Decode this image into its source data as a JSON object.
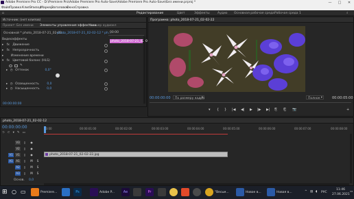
{
  "window": {
    "title": "Adobe Premiere Pro CC - D:\\Premiere Pro\\Adobe Premiere Pro Auto-Save\\Adobe Premiere Pro Auto-Save\\Без имени.prproj *",
    "controls": [
      "—",
      "□",
      "✕"
    ]
  },
  "menu": [
    "Файл",
    "Правка",
    "Клип",
    "Эпизод",
    "Маркер",
    "Заголовок",
    "Окно",
    "Справка"
  ],
  "workspaces": {
    "items": [
      "Редактирование",
      "Цвет",
      "Эффекты",
      "Аудио",
      "Основная рабочая среда",
      "Рабочая среда 1"
    ],
    "active": "Редактирование"
  },
  "effect_controls": {
    "tabs": [
      "Источник: (нет клипов)",
      "Элементы управления эффектами",
      "Микшер аудиокл"
    ],
    "master": "Основной * photo_2018-07-21_02-02...",
    "sequence": "photo_2018-07-21_02-02-12 * ph...",
    "timecode_ruler": [
      "00:00",
      "00:00:05:00"
    ],
    "clip_label": "photo_2018-07-21_02-02",
    "section": "Видеоэффекты",
    "effects": [
      {
        "name": "Движение",
        "prefix": "fx"
      },
      {
        "name": "Непрозрачность",
        "prefix": "fx"
      },
      {
        "name": "Изменение времени",
        "prefix": ""
      },
      {
        "name": "Цветовой баланс (HLS)",
        "prefix": "fx"
      }
    ],
    "params": [
      {
        "name": "Оттенок",
        "value": "0,0°"
      },
      {
        "name": "Освещенность",
        "value": "0,0"
      },
      {
        "name": "Насыщенность",
        "value": "0,0"
      }
    ],
    "footer_time": "00:00:00:00"
  },
  "program": {
    "title": "Программа: photo_2018-07-21_02-02-22",
    "timecode_left": "00:00:00:00",
    "fit": "По размеру кадра",
    "quality": "Полное",
    "timecode_right": "00:00:05:00",
    "transport": [
      "▾",
      "{",
      "}",
      "|◀",
      "◀|",
      "▶",
      "|▶",
      "▶|",
      "⎘",
      "⎗",
      "📷",
      "+"
    ],
    "image_desc": "flowers"
  },
  "timeline": {
    "tab": "photo_2018-07-21_02-02-12",
    "timecode": "00:00:00:00",
    "ruler": [
      "00:00",
      "00:00:01:00",
      "00:00:02:00",
      "00:00:03:00",
      "00:00:04:00",
      "00:00:05:00",
      "00:00:06:00",
      "00:00:07:00",
      "00:00:08:00",
      "00:00:09:00"
    ],
    "video_tracks": [
      "V3",
      "V2",
      "V1"
    ],
    "audio_tracks": [
      "A1",
      "A2",
      "A3"
    ],
    "master": "Основ.",
    "master_value": "0,0",
    "clip": "photo_2018-07-21_02-02-22.jpg",
    "track_buttons": [
      "M",
      "S"
    ]
  },
  "taskbar": {
    "items": [
      "Premiere...",
      "",
      "Ps",
      "Adobe P...",
      "Ae",
      "",
      "Pr",
      "",
      "\"Весьм...",
      "Новое в...",
      "Новая в..."
    ],
    "time": "11:46",
    "date": "27.06.2021",
    "lang": "РУС"
  },
  "colors": {
    "accent": "#5a9be0",
    "clip_pink": "#cf6ad1",
    "workarea_red": "#c23b3b",
    "clip_gray": "#bdbdbd"
  }
}
